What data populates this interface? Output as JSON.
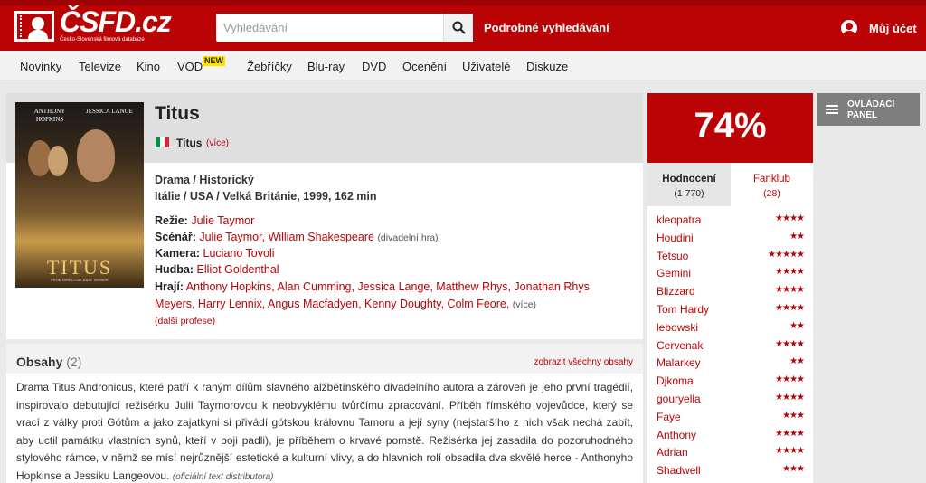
{
  "header": {
    "logo_text": "ČSFD.cz",
    "logo_sub": "Česko-Slovenská filmová databáze",
    "search_placeholder": "Vyhledávání",
    "advanced_search": "Podrobné vyhledávání",
    "account": "Můj účet",
    "colors": {
      "brand": "#ba0305"
    }
  },
  "nav": {
    "items": [
      "Novinky",
      "Televize",
      "Kino",
      "VOD",
      "Žebříčky",
      "Blu-ray",
      "DVD",
      "Ocenění",
      "Uživatelé",
      "Diskuze"
    ],
    "badge": "NEW"
  },
  "film": {
    "poster": {
      "actor1": "ANTHONY HOPKINS",
      "actor2": "JESSICA LANGE",
      "title": "TITUS",
      "tagline": "FROM DIRECTOR JULIE TAYMOR"
    },
    "title": "Titus",
    "orig_title": "Titus",
    "orig_more": "(více)",
    "genre": "Drama / Historický",
    "origin": "Itálie / USA / Velká Británie, 1999, 162 min",
    "credits": {
      "rezie_label": "Režie:",
      "rezie": "Julie Taymor",
      "scenar_label": "Scénář:",
      "scenar": "Julie Taymor, William Shakespeare",
      "scenar_note": "(divadelní hra)",
      "kamera_label": "Kamera:",
      "kamera": "Luciano Tovoli",
      "hudba_label": "Hudba:",
      "hudba": "Elliot Goldenthal",
      "hraji_label": "Hrají:",
      "hraji_line1": "Anthony Hopkins, Alan Cumming, Jessica Lange, Matthew Rhys, Jonathan Rhys",
      "hraji_line2": "Meyers, Harry Lennix, Angus Macfadyen, Kenny Doughty, Colm Feore,",
      "hraji_more": "(více)",
      "more_prof": "(další profese)"
    }
  },
  "obsahy": {
    "title": "Obsahy",
    "count": "(2)",
    "show_all": "zobrazit všechny obsahy",
    "text": "Drama Titus Andronicus, které patří k raným dílům slavného alžbětínského divadelního autora a zároveň je jeho první tragédií, inspirovalo debutující režisérku Julii Taymorovou k neobvyklému tvůrčímu zpracování. Příběh římského vojevůdce, který se vrací z války proti Gótům a jako zajatkyni si přivádí gótskou královnu Tamoru a její syny (nejstaršího z nich však nechá zabít, aby uctil památku vlastních synů, kteří v boji padli), je příběhem o krvavé pomstě. Režisérka jej zasadila do pozoruhodného stylového rámce, v němž se mísí nejrůznější estetické a kulturní vlivy, a do hlavních rolí obsadila dva skvělé herce - Anthonyho Hopkinse a Jessiku Langeovou.",
    "distributor": "(oficiální text distributora)"
  },
  "rating": {
    "score": "74%",
    "tab_ratings": "Hodnocení",
    "tab_ratings_count": "(1 770)",
    "tab_fanclub": "Fanklub",
    "tab_fanclub_count": "(28)",
    "users": [
      {
        "name": "kleopatra",
        "stars": "★★★★"
      },
      {
        "name": "Houdini",
        "stars": "★★"
      },
      {
        "name": "Tetsuo",
        "stars": "★★★★★"
      },
      {
        "name": "Gemini",
        "stars": "★★★★"
      },
      {
        "name": "Blizzard",
        "stars": "★★★★"
      },
      {
        "name": "Tom Hardy",
        "stars": "★★★★"
      },
      {
        "name": "lebowski",
        "stars": "★★"
      },
      {
        "name": "Cervenak",
        "stars": "★★★★"
      },
      {
        "name": "Malarkey",
        "stars": "★★"
      },
      {
        "name": "Djkoma",
        "stars": "★★★★"
      },
      {
        "name": "gouryella",
        "stars": "★★★★"
      },
      {
        "name": "Faye",
        "stars": "★★★"
      },
      {
        "name": "Anthony",
        "stars": "★★★★"
      },
      {
        "name": "Adrian",
        "stars": "★★★★"
      },
      {
        "name": "Shadwell",
        "stars": "★★★"
      }
    ]
  },
  "control_panel": {
    "line1": "OVLÁDACÍ",
    "line2": "PANEL"
  }
}
